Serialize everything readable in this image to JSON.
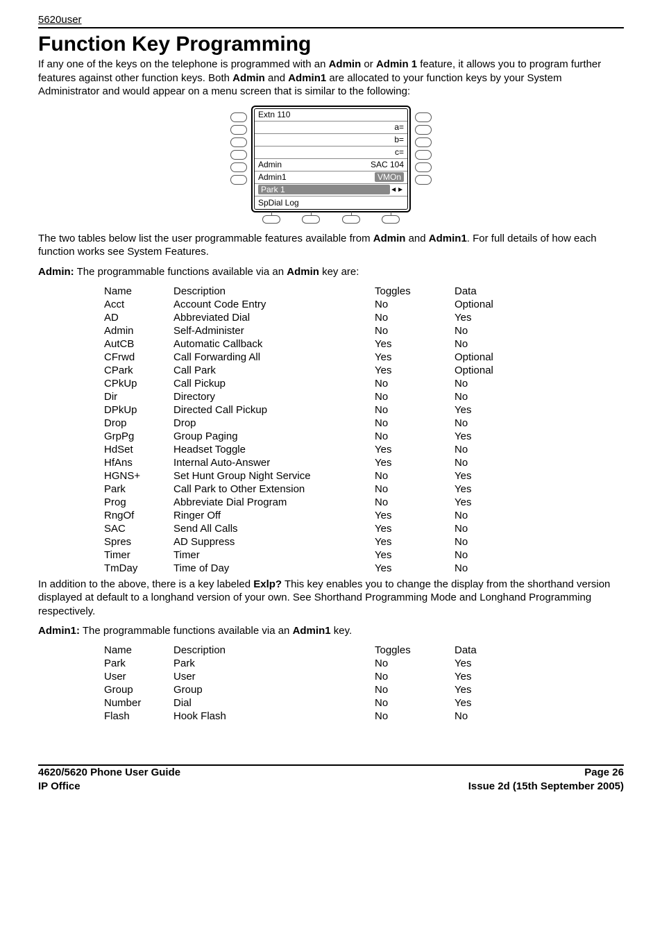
{
  "header": {
    "small": "5620user"
  },
  "title": "Function Key Programming",
  "intro": {
    "p1a": "If any one of the keys on the telephone is programmed with an ",
    "p1b": "Admin",
    "p1c": " or ",
    "p1d": "Admin 1",
    "p1e": " feature, it allows you to program further features against other function keys. Both ",
    "p1f": "Admin",
    "p1g": " and ",
    "p1h": "Admin1",
    "p1i": " are allocated to your function keys by your System Administrator and would appear on a menu screen that is similar to the following:"
  },
  "lcd": {
    "r1l": "Extn 110",
    "r1r": "",
    "r2l": "",
    "r2r": "a=",
    "r3l": "",
    "r3r": "b=",
    "r4l": "",
    "r4r": "c=",
    "r5l": "Admin",
    "r5r": "SAC 104",
    "r6l": "Admin1",
    "r6r": "VMOn",
    "r7l": "Park 1",
    "r7r": "",
    "r8l": "SpDial     Log",
    "r8r": ""
  },
  "mid": {
    "p2a": "The two tables below list the user programmable features available from ",
    "p2b": "Admin",
    "p2c": " and ",
    "p2d": "Admin1",
    "p2e": ". For full details of how each function works see System Features.",
    "p3a": "Admin:",
    "p3b": " The programmable functions available via an ",
    "p3c": "Admin",
    "p3d": " key are:"
  },
  "table1": {
    "head": {
      "c1": "Name",
      "c2": "Description",
      "c3": "Toggles",
      "c4": "Data"
    },
    "rows": [
      {
        "c1": "Acct",
        "c2": "Account Code Entry",
        "c3": "No",
        "c4": "Optional"
      },
      {
        "c1": "AD",
        "c2": "Abbreviated Dial",
        "c3": "No",
        "c4": "Yes"
      },
      {
        "c1": "Admin",
        "c2": "Self-Administer",
        "c3": "No",
        "c4": "No"
      },
      {
        "c1": "AutCB",
        "c2": "Automatic Callback",
        "c3": "Yes",
        "c4": "No"
      },
      {
        "c1": "CFrwd",
        "c2": "Call Forwarding All",
        "c3": "Yes",
        "c4": "Optional"
      },
      {
        "c1": "CPark",
        "c2": "Call Park",
        "c3": "Yes",
        "c4": "Optional"
      },
      {
        "c1": "CPkUp",
        "c2": "Call Pickup",
        "c3": "No",
        "c4": "No"
      },
      {
        "c1": "Dir",
        "c2": "Directory",
        "c3": "No",
        "c4": "No"
      },
      {
        "c1": "DPkUp",
        "c2": "Directed Call Pickup",
        "c3": "No",
        "c4": "Yes"
      },
      {
        "c1": "Drop",
        "c2": "Drop",
        "c3": "No",
        "c4": "No"
      },
      {
        "c1": "GrpPg",
        "c2": "Group Paging",
        "c3": "No",
        "c4": "Yes"
      },
      {
        "c1": "HdSet",
        "c2": "Headset Toggle",
        "c3": "Yes",
        "c4": "No"
      },
      {
        "c1": "HfAns",
        "c2": "Internal Auto-Answer",
        "c3": "Yes",
        "c4": "No"
      },
      {
        "c1": "HGNS+",
        "c2": "Set Hunt Group Night Service",
        "c3": "No",
        "c4": "Yes"
      },
      {
        "c1": "Park",
        "c2": "Call Park to Other Extension",
        "c3": "No",
        "c4": "Yes"
      },
      {
        "c1": "Prog",
        "c2": "Abbreviate Dial Program",
        "c3": "No",
        "c4": "Yes"
      },
      {
        "c1": "RngOf",
        "c2": "Ringer Off",
        "c3": "Yes",
        "c4": "No"
      },
      {
        "c1": "SAC",
        "c2": "Send All Calls",
        "c3": "Yes",
        "c4": "No"
      },
      {
        "c1": "Spres",
        "c2": "AD Suppress",
        "c3": "Yes",
        "c4": "No"
      },
      {
        "c1": "Timer",
        "c2": "Timer",
        "c3": "Yes",
        "c4": "No"
      },
      {
        "c1": "TmDay",
        "c2": "Time of Day",
        "c3": "Yes",
        "c4": "No"
      }
    ]
  },
  "mid2": {
    "p4a": "In addition to the above, there is a key labeled ",
    "p4b": "Exlp?",
    "p4c": " This key enables you to change the display from the shorthand version displayed at default to a longhand version of your own. See Shorthand Programming Mode and Longhand Programming respectively.",
    "p5a": "Admin1:",
    "p5b": " The programmable functions available via an ",
    "p5c": "Admin1",
    "p5d": " key."
  },
  "table2": {
    "head": {
      "c1": "Name",
      "c2": "Description",
      "c3": "Toggles",
      "c4": "Data"
    },
    "rows": [
      {
        "c1": "Park",
        "c2": "Park",
        "c3": "No",
        "c4": "Yes"
      },
      {
        "c1": "User",
        "c2": "User",
        "c3": "No",
        "c4": "Yes"
      },
      {
        "c1": "Group",
        "c2": "Group",
        "c3": "No",
        "c4": "Yes"
      },
      {
        "c1": "Number",
        "c2": "Dial",
        "c3": "No",
        "c4": "Yes"
      },
      {
        "c1": "Flash",
        "c2": "Hook Flash",
        "c3": "No",
        "c4": "No"
      }
    ]
  },
  "footer": {
    "l1": "4620/5620 Phone User Guide",
    "l2": "IP Office",
    "r1": "Page 26",
    "r2": "Issue 2d (15th September 2005)"
  }
}
